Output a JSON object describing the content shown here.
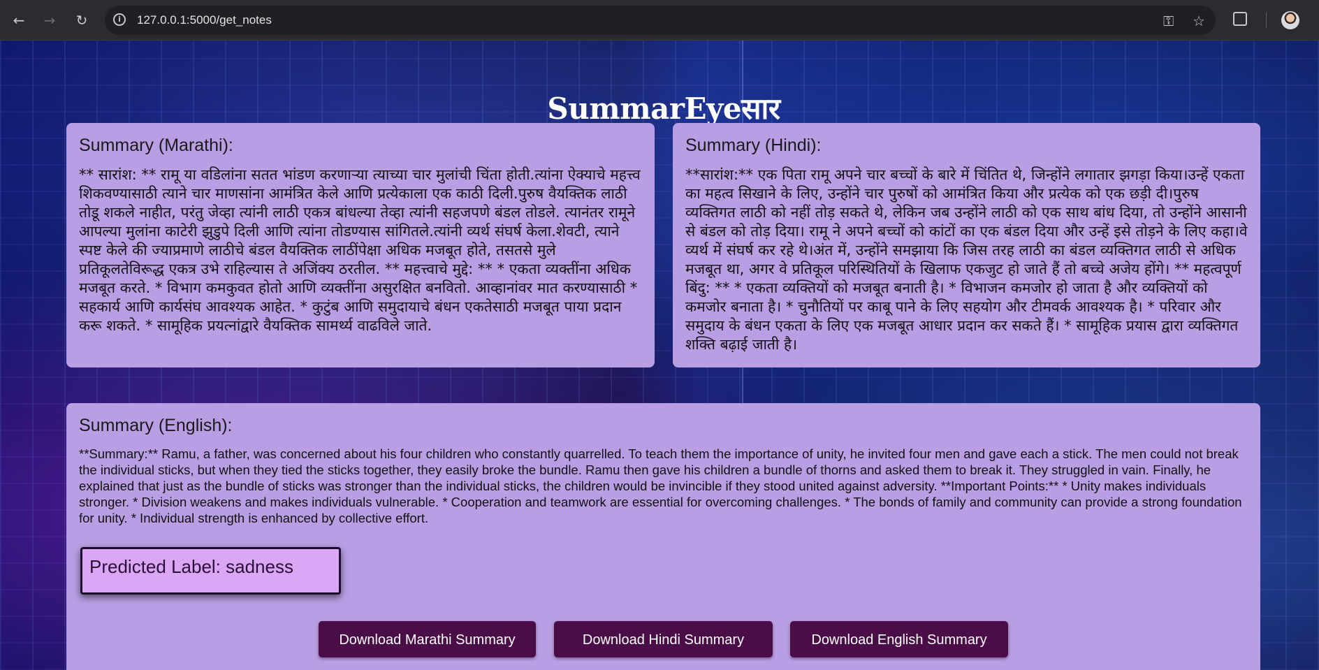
{
  "browser": {
    "url": "127.0.0.1:5000/get_notes",
    "back_icon": "←",
    "forward_icon": "→",
    "reload_icon": "↻",
    "key_icon": "⚿",
    "star_icon": "☆"
  },
  "site": {
    "title": "SummarEyeसार"
  },
  "marathi": {
    "heading": "Summary (Marathi):",
    "text": "** सारांश: ** रामू या वडिलांना सतत भांडण करणाऱ्या त्याच्या चार मुलांची चिंता होती.त्यांना ऐक्याचे महत्त्व शिकवण्यासाठी त्याने चार माणसांना आमंत्रित केले आणि प्रत्येकाला एक काठी दिली.पुरुष वैयक्तिक लाठी तोडू शकले नाहीत, परंतु जेव्हा त्यांनी लाठी एकत्र बांधल्या तेव्हा त्यांनी सहजपणे बंडल तोडले. त्यानंतर रामूने आपल्या मुलांना काटेरी झुडुपे दिली आणि त्यांना तोडण्यास सांगितले.त्यांनी व्यर्थ संघर्ष केला.शेवटी, त्याने स्पष्ट केले की ज्याप्रमाणे लाठीचे बंडल वैयक्तिक लाठींपेक्षा अधिक मजबूत होते, तसतसे मुले प्रतिकूलतेविरूद्ध एकत्र उभे राहिल्यास ते अजिंक्य ठरतील. ** महत्त्वाचे मुद्दे: ** * एकता व्यक्तींना अधिक मजबूत करते. * विभाग कमकुवत होतो आणि व्यक्तींना असुरक्षित बनवितो. आव्हानांवर मात करण्यासाठी * सहकार्य आणि कार्यसंघ आवश्यक आहेत. * कुटुंब आणि समुदायाचे बंधन एकतेसाठी मजबूत पाया प्रदान करू शकते. * सामूहिक प्रयत्नांद्वारे वैयक्तिक सामर्थ्य वाढविले जाते."
  },
  "hindi": {
    "heading": "Summary (Hindi):",
    "text": "**सारांश:** एक पिता रामू अपने चार बच्चों के बारे में चिंतित थे, जिन्होंने लगातार झगड़ा किया।उन्हें एकता का महत्व सिखाने के लिए, उन्होंने चार पुरुषों को आमंत्रित किया और प्रत्येक को एक छड़ी दी।पुरुष व्यक्तिगत लाठी को नहीं तोड़ सकते थे, लेकिन जब उन्होंने लाठी को एक साथ बांध दिया, तो उन्होंने आसानी से बंडल को तोड़ दिया। रामू ने अपने बच्चों को कांटों का एक बंडल दिया और उन्हें इसे तोड़ने के लिए कहा।वे व्यर्थ में संघर्ष कर रहे थे।अंत में, उन्होंने समझाया कि जिस तरह लाठी का बंडल व्यक्तिगत लाठी से अधिक मजबूत था, अगर वे प्रतिकूल परिस्थितियों के खिलाफ एकजुट हो जाते हैं तो बच्चे अजेय होंगे। ** महत्वपूर्ण बिंदु: ** * एकता व्यक्तियों को मजबूत बनाती है। * विभाजन कमजोर हो जाता है और व्यक्तियों को कमजोर बनाता है। * चुनौतियों पर काबू पाने के लिए सहयोग और टीमवर्क आवश्यक है। * परिवार और समुदाय के बंधन एकता के लिए एक मजबूत आधार प्रदान कर सकते हैं। * सामूहिक प्रयास द्वारा व्यक्तिगत शक्ति बढ़ाई जाती है।"
  },
  "english": {
    "heading": "Summary (English):",
    "text": "**Summary:** Ramu, a father, was concerned about his four children who constantly quarrelled. To teach them the importance of unity, he invited four men and gave each a stick. The men could not break the individual sticks, but when they tied the sticks together, they easily broke the bundle. Ramu then gave his children a bundle of thorns and asked them to break it. They struggled in vain. Finally, he explained that just as the bundle of sticks was stronger than the individual sticks, the children would be invincible if they stood united against adversity. **Important Points:** * Unity makes individuals stronger. * Division weakens and makes individuals vulnerable. * Cooperation and teamwork are essential for overcoming challenges. * The bonds of family and community can provide a strong foundation for unity. * Individual strength is enhanced by collective effort."
  },
  "prediction": {
    "label": "Predicted Label: sadness"
  },
  "downloads": {
    "marathi": "Download Marathi Summary",
    "hindi": "Download Hindi Summary",
    "english": "Download English Summary"
  },
  "colors": {
    "card": "#b99ee3",
    "button": "#4a0d48",
    "label_box": "#dba6f3"
  }
}
